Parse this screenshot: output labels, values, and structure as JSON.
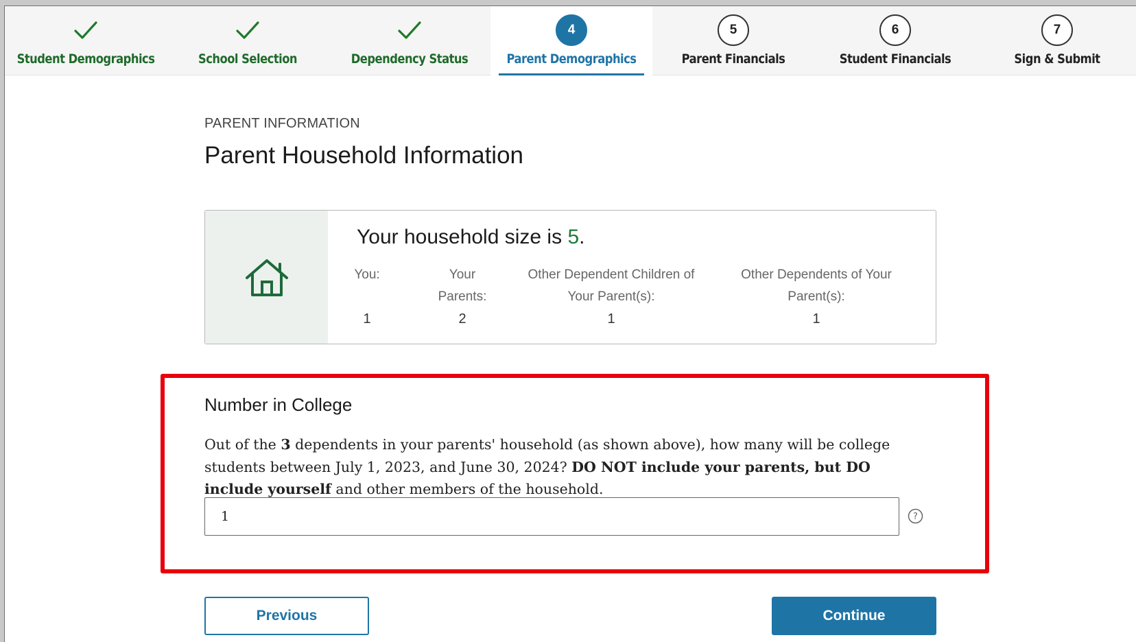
{
  "stepper": {
    "steps": [
      {
        "label": "Student Demographics",
        "status": "done",
        "icon": "check-icon"
      },
      {
        "label": "School Selection",
        "status": "done",
        "icon": "check-icon"
      },
      {
        "label": "Dependency Status",
        "status": "done",
        "icon": "check-icon"
      },
      {
        "number": "4",
        "label": "Parent Demographics",
        "status": "active"
      },
      {
        "number": "5",
        "label": "Parent Financials",
        "status": "upcoming"
      },
      {
        "number": "6",
        "label": "Student Financials",
        "status": "upcoming"
      },
      {
        "number": "7",
        "label": "Sign & Submit",
        "status": "upcoming"
      }
    ]
  },
  "section": {
    "eyebrow": "PARENT INFORMATION",
    "title": "Parent Household Information"
  },
  "household": {
    "icon": "house-icon",
    "size_text": "Your household size is ",
    "size_value": "5",
    "size_suffix": ".",
    "columns": [
      {
        "label_line1": "You:",
        "label_line2": "",
        "value": "1"
      },
      {
        "label_line1": "Your",
        "label_line2": "Parents:",
        "value": "2"
      },
      {
        "label_line1": "Other Dependent Children of",
        "label_line2": "Your Parent(s):",
        "value": "1"
      },
      {
        "label_line1": "Other Dependents of Your",
        "label_line2": "Parent(s):",
        "value": "1"
      }
    ]
  },
  "question": {
    "title": "Number in College",
    "text_1": "Out of the ",
    "text_bold_num": "3",
    "text_2": " dependents in your parents' household (as shown above), how many will be college students between July 1, 2023, and June 30, 2024? ",
    "text_bold_instr": "DO NOT include your parents, but DO include yourself",
    "text_3": " and other members of the household.",
    "answer_value": "1",
    "help_icon": "question-circle-icon"
  },
  "buttons": {
    "previous": "Previous",
    "continue": "Continue"
  },
  "colors": {
    "accent": "#1f74a6",
    "done_green": "#1e6a2a",
    "highlight_red": "#e8000c"
  }
}
